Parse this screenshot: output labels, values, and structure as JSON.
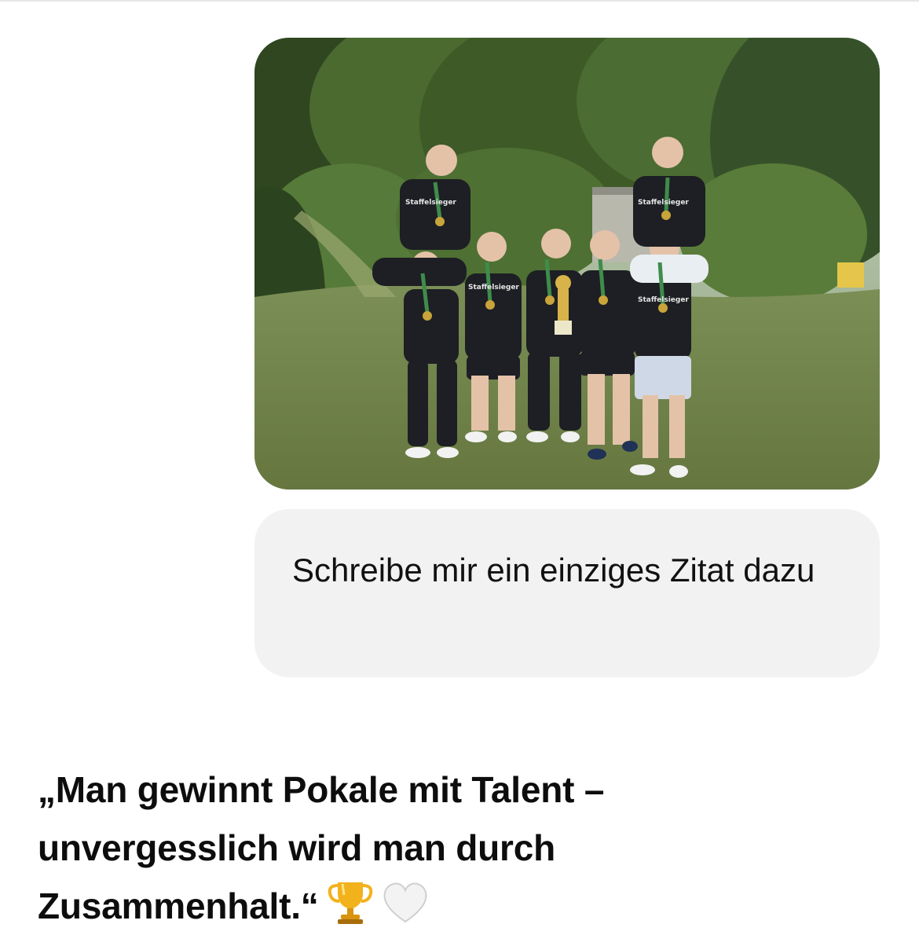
{
  "conversation": {
    "user_image": {
      "shirt_text": "Staffelsieger"
    },
    "user_message": "Schreibe mir ein einziges Zitat dazu",
    "assistant_message": "„Man gewinnt Pokale mit Talent – unvergesslich wird man durch Zusammenhalt.“",
    "assistant_emojis": [
      "trophy-icon",
      "white-heart-icon"
    ]
  },
  "colors": {
    "user_bubble_bg": "#f2f2f2",
    "text": "#0d0d0d",
    "background": "#ffffff"
  }
}
